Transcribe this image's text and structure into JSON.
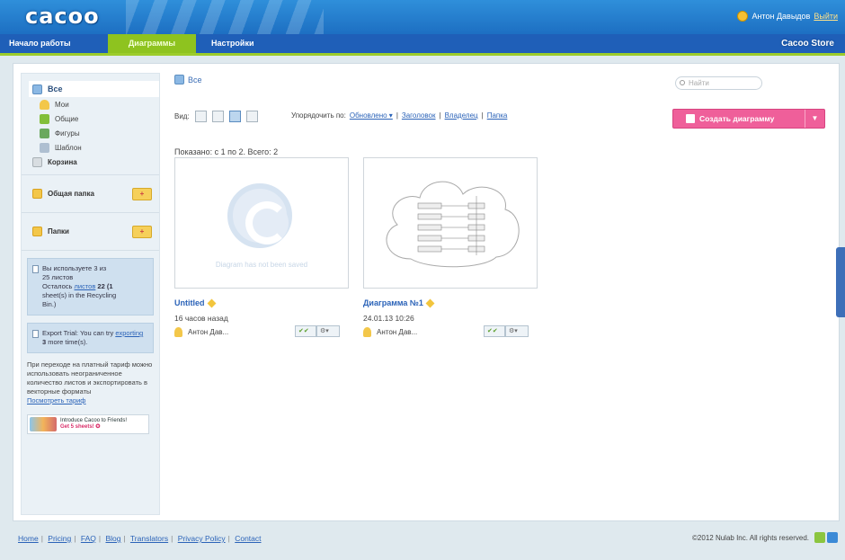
{
  "header": {
    "logo": "cacoo",
    "user_name": "Антон Давыдов",
    "logout": "Выйти",
    "nav": {
      "home": "Начало работы",
      "diagrams": "Диаграммы",
      "settings": "Настройки"
    },
    "store": "Cacoo Store"
  },
  "sidebar": {
    "all": "Все",
    "mine": "Мои",
    "shared": "Общие",
    "shapes": "Фигуры",
    "template": "Шаблон",
    "trash": "Корзина",
    "shared_folder": "Общая папка",
    "folders": "Папки",
    "usage": {
      "line1": "Вы используете 3 из",
      "line2": "25 листов",
      "line3_pre": "Осталось",
      "line3_link": "листов",
      "line3_count": "22",
      "line3_post": "(1",
      "line4": "sheet(s) in the Recycling",
      "line5": "Bin.)"
    },
    "export": {
      "pre": "Export Trial: You can try",
      "link": "exporting",
      "count": "3",
      "post": "more time(s)."
    },
    "upsell": "При переходе на платный тариф можно использовать неограниченное количество листов и экспортировать в векторные форматы",
    "upsell_link": "Посмотреть тариф",
    "promo_line1": "Introduce Cacoo to Friends!",
    "promo_line2": "Get 5 sheets! ✪"
  },
  "content": {
    "breadcrumb": "Все",
    "search_placeholder": "Найти",
    "view_label": "Вид:",
    "sort_label": "Упорядочить по:",
    "sort_options": [
      "Обновлено ▾",
      "Заголовок",
      "Владелец",
      "Папка"
    ],
    "create_button": "Создать диаграмму",
    "showing": "Показано: с 1 по 2. Всего: 2"
  },
  "cards": [
    {
      "title": "Untitled",
      "date": "16 часов назад",
      "owner": "Антон Дав...",
      "placeholder": "Diagram has not been saved"
    },
    {
      "title": "Диаграмма №1",
      "date": "24.01.13 10:26",
      "owner": "Антон Дав..."
    }
  ],
  "footer": {
    "links": [
      "Home",
      "Pricing",
      "FAQ",
      "Blog",
      "Translators",
      "Privacy Policy",
      "Contact"
    ],
    "copyright": "©2012 Nulab Inc. All rights reserved."
  }
}
